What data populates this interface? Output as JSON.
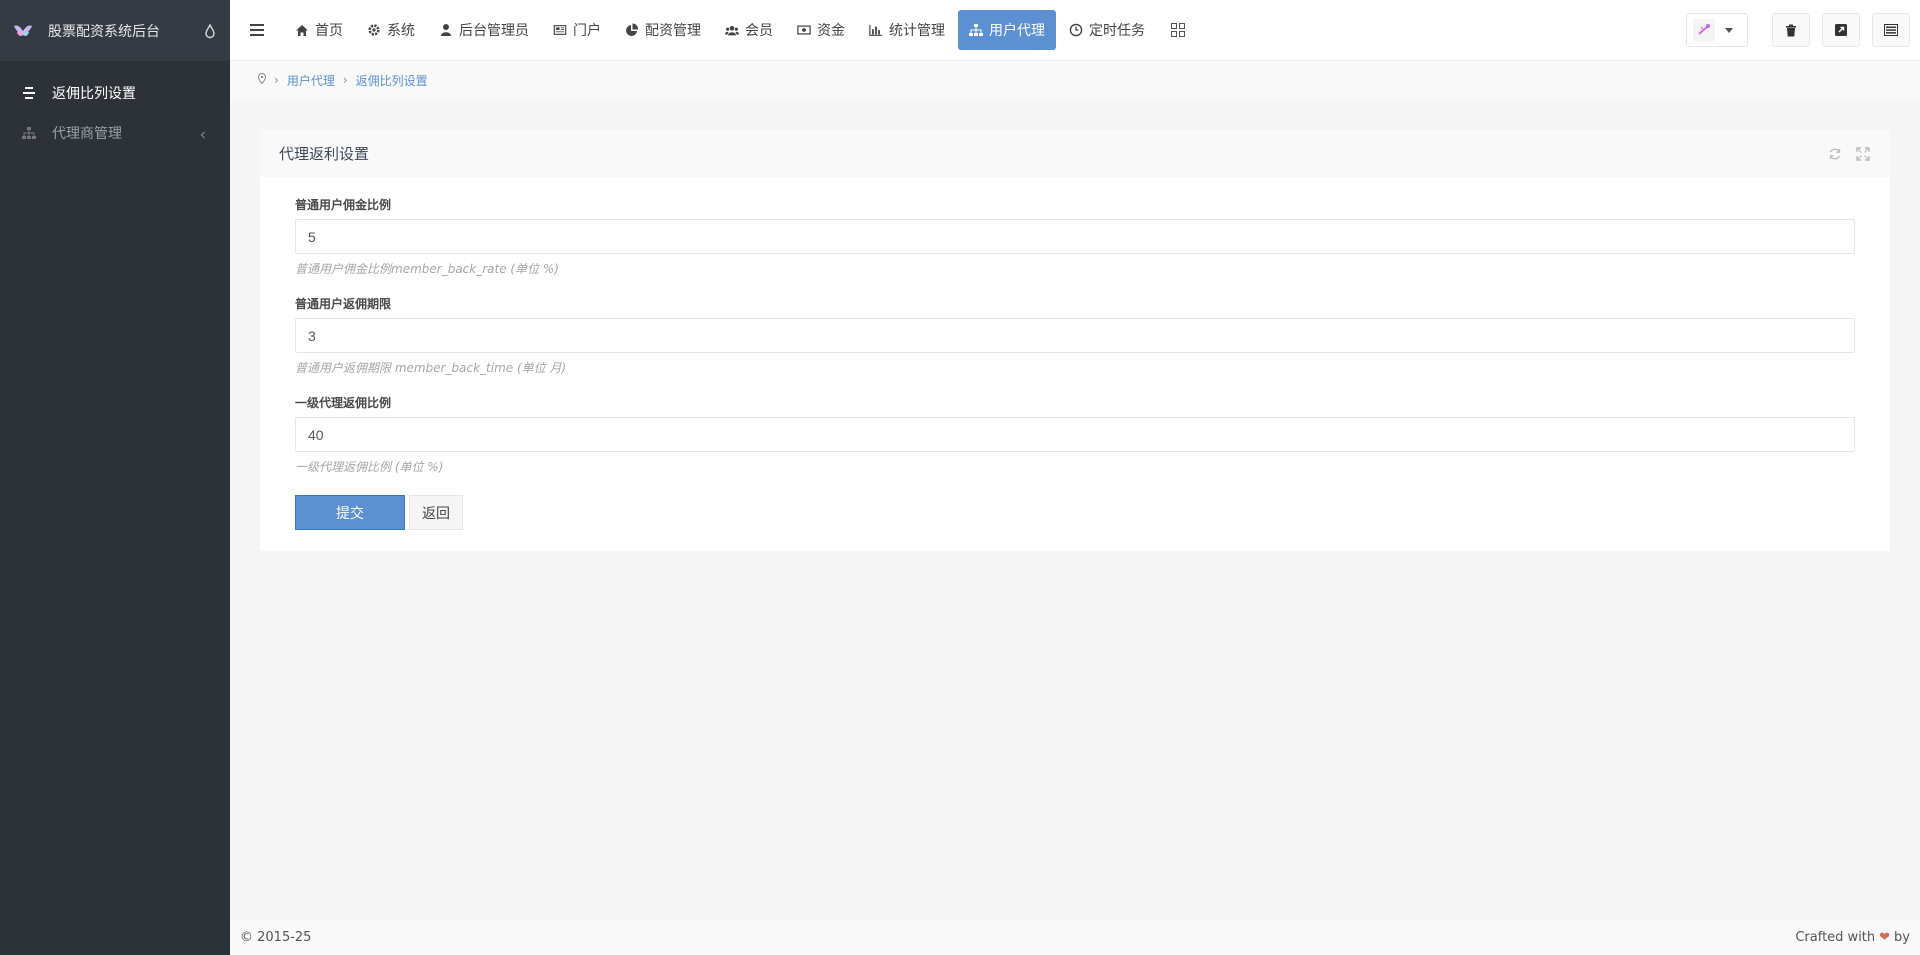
{
  "app": {
    "brand": "股票配资系统后台"
  },
  "sidebar": {
    "items": [
      {
        "label": "返佣比列设置",
        "icon": "list-icon",
        "active": true
      },
      {
        "label": "代理商管理",
        "icon": "sitemap-icon",
        "active": false
      }
    ]
  },
  "topnav": {
    "items": [
      {
        "label": "首页",
        "icon": "home-icon"
      },
      {
        "label": "系统",
        "icon": "gear-icon"
      },
      {
        "label": "后台管理员",
        "icon": "user-icon"
      },
      {
        "label": "门户",
        "icon": "newspaper-icon"
      },
      {
        "label": "配资管理",
        "icon": "pie-chart-icon"
      },
      {
        "label": "会员",
        "icon": "users-icon"
      },
      {
        "label": "资金",
        "icon": "money-icon"
      },
      {
        "label": "统计管理",
        "icon": "bar-chart-icon"
      },
      {
        "label": "用户代理",
        "icon": "sitemap-icon",
        "active": true
      },
      {
        "label": "定时任务",
        "icon": "clock-icon"
      }
    ]
  },
  "breadcrumb": {
    "items": [
      "用户代理",
      "返佣比列设置"
    ]
  },
  "panel": {
    "title": "代理返利设置",
    "fields": [
      {
        "label": "普通用户佣金比例",
        "value": "5",
        "help": "普通用户佣金比例member_back_rate (单位 %)"
      },
      {
        "label": "普通用户返佣期限",
        "value": "3",
        "help": "普通用户返佣期限 member_back_time (单位 月)"
      },
      {
        "label": "一级代理返佣比例",
        "value": "40",
        "help": "一级代理返佣比例 (单位 %)"
      }
    ],
    "submit_label": "提交",
    "back_label": "返回"
  },
  "footer": {
    "copyright": "© 2015-25",
    "crafted_prefix": "Crafted with",
    "crafted_suffix": "by",
    "heart": "❤"
  },
  "colors": {
    "accent": "#5c90d2",
    "sidebar_bg": "#2d3238",
    "heart": "#d26a5c"
  }
}
